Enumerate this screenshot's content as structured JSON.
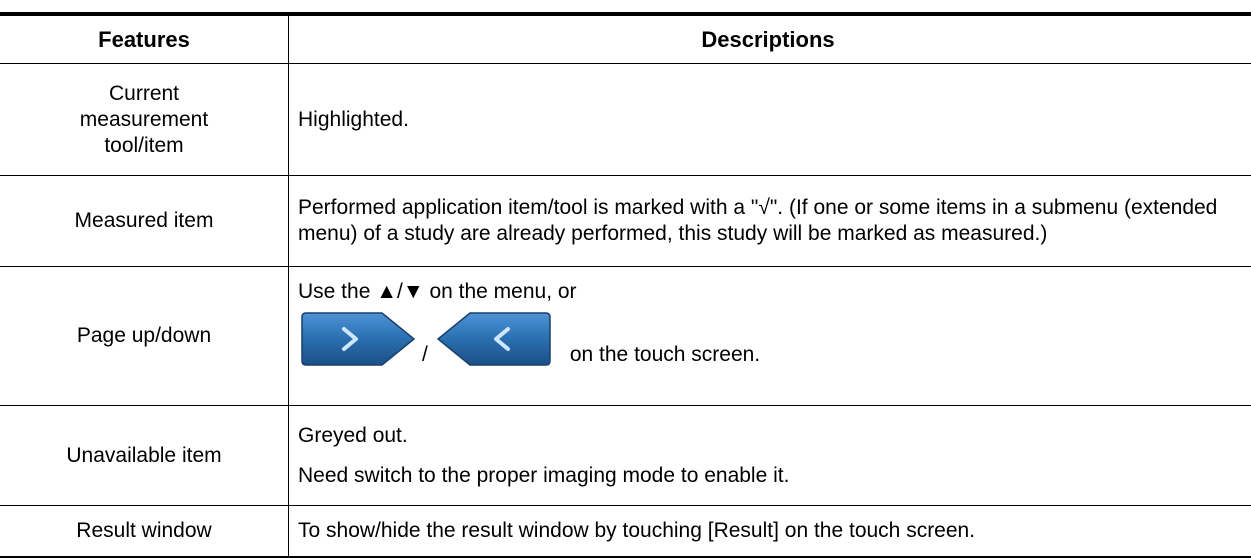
{
  "table": {
    "headers": {
      "features": "Features",
      "descriptions": "Descriptions"
    },
    "rows": [
      {
        "feature": "Current measurement tool/item",
        "description": "Highlighted."
      },
      {
        "feature": "Measured item",
        "description": "Performed application item/tool is marked with a \"√\". (If one or some items in a submenu (extended menu) of a study are already performed, this study will be marked as measured.)"
      },
      {
        "feature": "Page up/down",
        "description_line1": "Use the ▲/▼ on the menu, or",
        "slash": "/",
        "description_line2": "on the touch screen."
      },
      {
        "feature": "Unavailable item",
        "description_line1": "Greyed out.",
        "description_line2": "Need switch to the proper imaging mode to enable it."
      },
      {
        "feature": "Result window",
        "description": "To show/hide the result window by touching [Result] on the touch screen."
      }
    ]
  },
  "icons": {
    "next": "page-forward-icon",
    "prev": "page-back-icon",
    "button_color": "#2a6fb0"
  }
}
